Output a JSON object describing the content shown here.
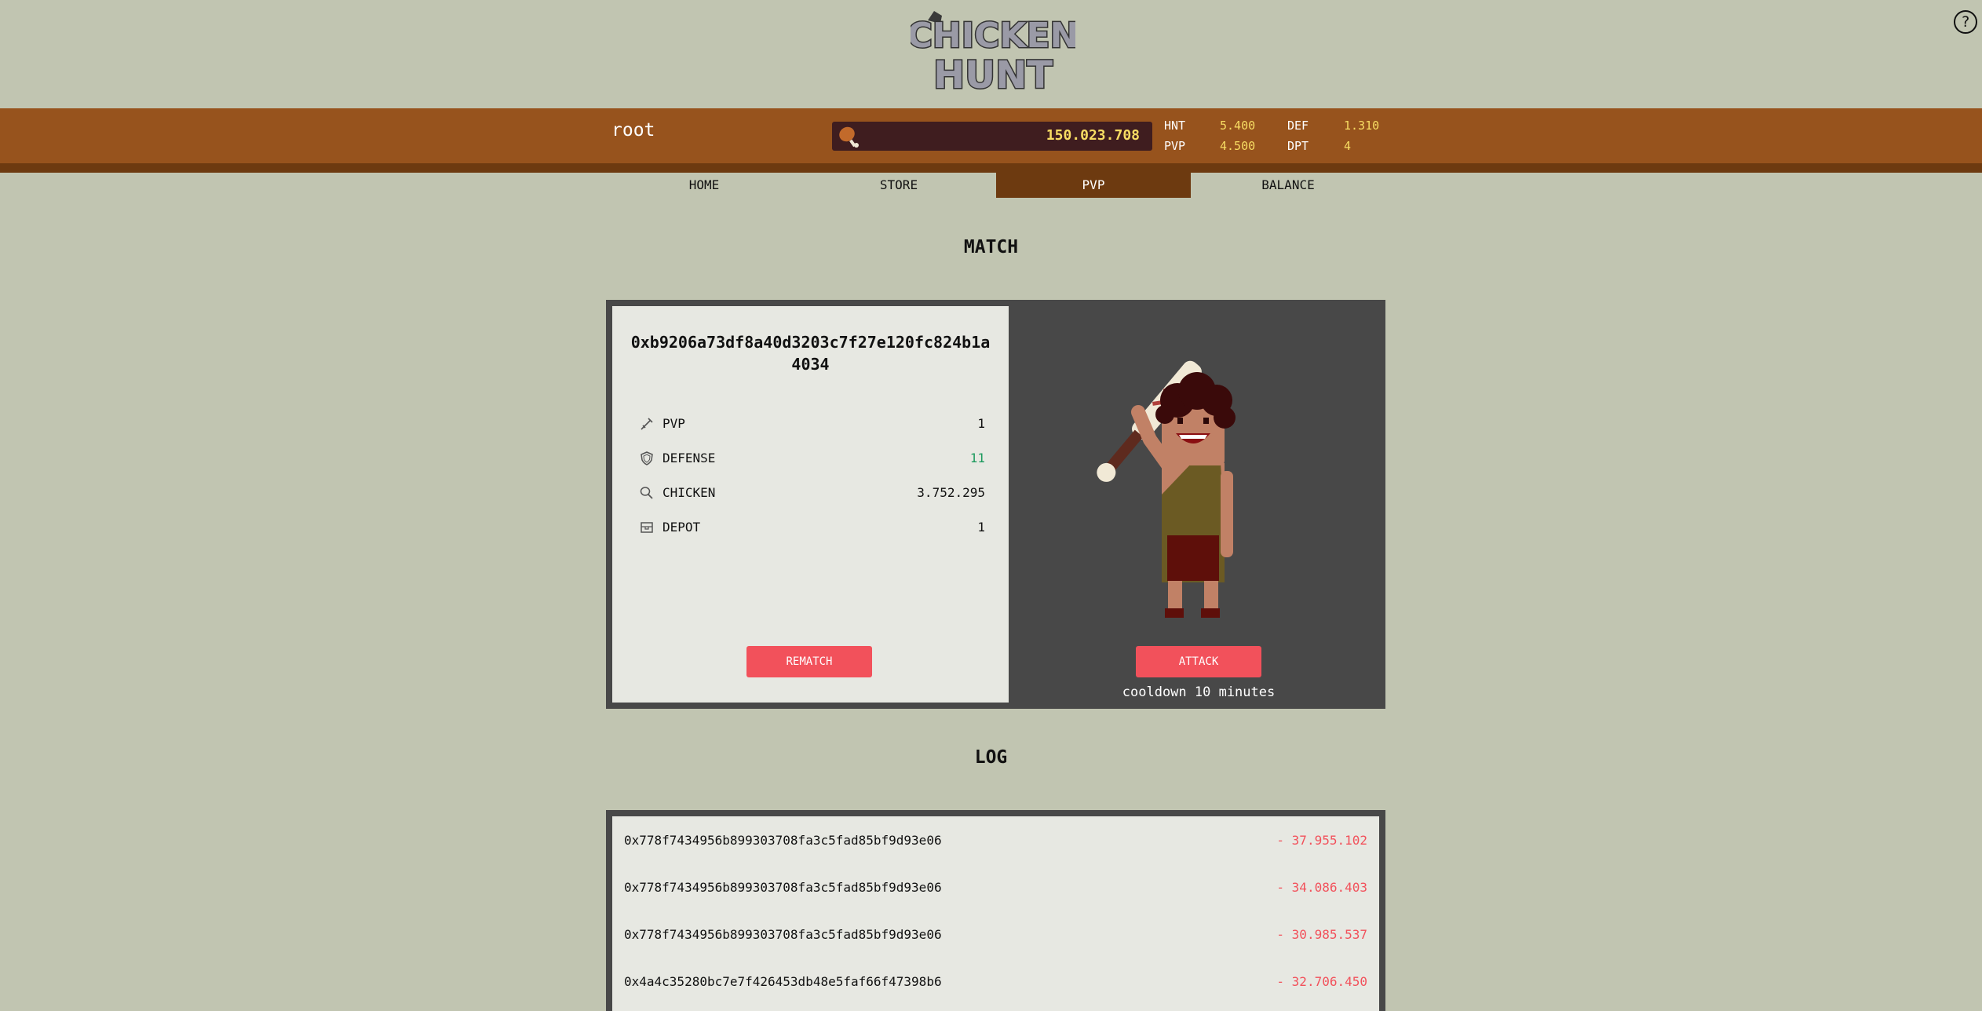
{
  "logo": {
    "text_top": "CHICKEN",
    "text_bottom": "HUNT"
  },
  "help": {
    "label": "?"
  },
  "header": {
    "username": "root",
    "balance": "150.023.708",
    "stats": [
      {
        "label": "HNT",
        "value": "5.400"
      },
      {
        "label": "DEF",
        "value": "1.310"
      },
      {
        "label": "PVP",
        "value": "4.500"
      },
      {
        "label": "DPT",
        "value": "4"
      }
    ]
  },
  "nav": {
    "tabs": [
      {
        "label": "HOME"
      },
      {
        "label": "STORE"
      },
      {
        "label": "PVP"
      },
      {
        "label": "BALANCE"
      }
    ],
    "active": "PVP"
  },
  "match": {
    "title": "MATCH",
    "opponent_address": "0xb9206a73df8a40d3203c7f27e120fc824b1a4034",
    "stats": [
      {
        "label": "PVP",
        "value": "1",
        "icon": "sword-icon"
      },
      {
        "label": "DEFENSE",
        "value": "11",
        "icon": "shield-icon"
      },
      {
        "label": "CHICKEN",
        "value": "3.752.295",
        "icon": "drumstick-icon"
      },
      {
        "label": "DEPOT",
        "value": "1",
        "icon": "depot-icon"
      }
    ],
    "rematch_label": "REMATCH",
    "attack_label": "ATTACK",
    "cooldown": "cooldown 10 minutes"
  },
  "log": {
    "title": "LOG",
    "entries": [
      {
        "address": "0x778f7434956b899303708fa3c5fad85bf9d93e06",
        "amount": "- 37.955.102"
      },
      {
        "address": "0x778f7434956b899303708fa3c5fad85bf9d93e06",
        "amount": "- 34.086.403"
      },
      {
        "address": "0x778f7434956b899303708fa3c5fad85bf9d93e06",
        "amount": "- 30.985.537"
      },
      {
        "address": "0x4a4c35280bc7e7f426453db48e5faf66f47398b6",
        "amount": "- 32.706.450"
      }
    ]
  },
  "colors": {
    "background": "#c1c5b1",
    "topbar": "#97531d",
    "active_tab": "#6d3a10",
    "accent_button": "#f2515b",
    "balance_text": "#f7dc63"
  }
}
